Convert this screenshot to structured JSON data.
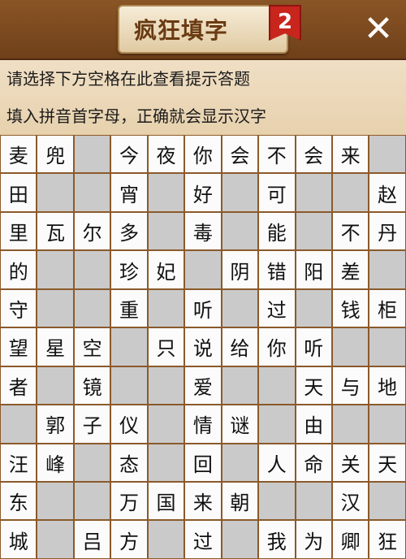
{
  "header": {
    "title": "疯狂填字",
    "badge": "2",
    "close_glyph": "✕"
  },
  "hints": {
    "line1": "请选择下方空格在此查看提示答题",
    "line2": "填入拼音首字母，正确就会显示汉字"
  },
  "grid": {
    "rows": [
      [
        "麦",
        "兜",
        "",
        "今",
        "夜",
        "你",
        "会",
        "不",
        "会",
        "来",
        ""
      ],
      [
        "田",
        "",
        "",
        "宵",
        "",
        "好",
        "",
        "可",
        "",
        "",
        "赵"
      ],
      [
        "里",
        "瓦",
        "尔",
        "多",
        "",
        "毒",
        "",
        "能",
        "",
        "不",
        "丹"
      ],
      [
        "的",
        "",
        "",
        "珍",
        "妃",
        "",
        "阴",
        "错",
        "阳",
        "差",
        ""
      ],
      [
        "守",
        "",
        "",
        "重",
        "",
        "听",
        "",
        "过",
        "",
        "钱",
        "柜"
      ],
      [
        "望",
        "星",
        "空",
        "",
        "只",
        "说",
        "给",
        "你",
        "听",
        "",
        ""
      ],
      [
        "者",
        "",
        "镜",
        "",
        "",
        "爱",
        "",
        "",
        "天",
        "与",
        "地"
      ],
      [
        "",
        "郭",
        "子",
        "仪",
        "",
        "情",
        "谜",
        "",
        "由",
        "",
        ""
      ],
      [
        "汪",
        "峰",
        "",
        "态",
        "",
        "回",
        "",
        "人",
        "命",
        "关",
        "天"
      ],
      [
        "东",
        "",
        "",
        "万",
        "国",
        "来",
        "朝",
        "",
        "",
        "汉",
        ""
      ],
      [
        "城",
        "",
        "吕",
        "方",
        "",
        "过",
        "",
        "我",
        "为",
        "卿",
        "狂"
      ]
    ],
    "types": [
      [
        "w",
        "w",
        "g",
        "w",
        "w",
        "w",
        "w",
        "w",
        "w",
        "w",
        "g"
      ],
      [
        "w",
        "g",
        "g",
        "w",
        "g",
        "w",
        "g",
        "w",
        "g",
        "g",
        "w"
      ],
      [
        "w",
        "w",
        "w",
        "w",
        "g",
        "w",
        "g",
        "w",
        "g",
        "w",
        "w"
      ],
      [
        "w",
        "g",
        "g",
        "w",
        "w",
        "g",
        "w",
        "w",
        "w",
        "w",
        "g"
      ],
      [
        "w",
        "g",
        "g",
        "w",
        "g",
        "w",
        "g",
        "w",
        "g",
        "w",
        "w"
      ],
      [
        "w",
        "w",
        "w",
        "g",
        "w",
        "w",
        "w",
        "w",
        "w",
        "g",
        "g"
      ],
      [
        "w",
        "g",
        "w",
        "g",
        "g",
        "w",
        "g",
        "g",
        "w",
        "w",
        "w"
      ],
      [
        "g",
        "w",
        "w",
        "w",
        "g",
        "w",
        "w",
        "g",
        "w",
        "g",
        "g"
      ],
      [
        "w",
        "w",
        "g",
        "w",
        "g",
        "w",
        "g",
        "w",
        "w",
        "w",
        "w"
      ],
      [
        "w",
        "g",
        "g",
        "w",
        "w",
        "w",
        "w",
        "g",
        "g",
        "w",
        "g"
      ],
      [
        "w",
        "g",
        "w",
        "w",
        "g",
        "w",
        "g",
        "w",
        "w",
        "w",
        "w"
      ]
    ]
  }
}
